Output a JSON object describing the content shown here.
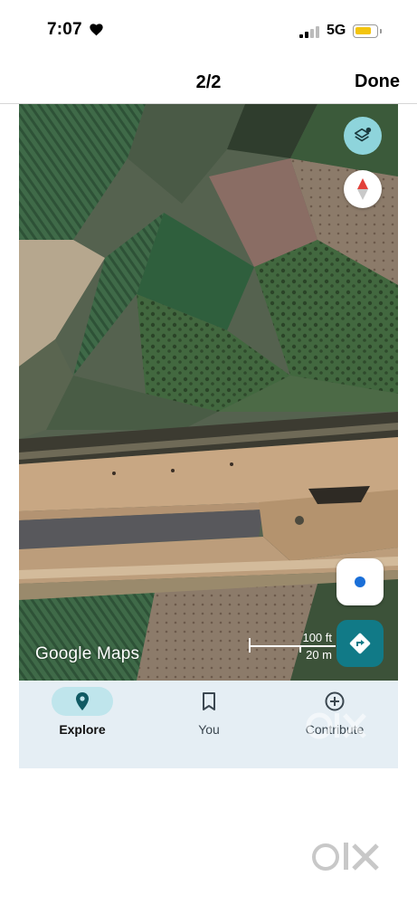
{
  "status_bar": {
    "time": "7:07",
    "network": "5G",
    "battery_color": "#f3c40e"
  },
  "header": {
    "title": "2/2",
    "done_label": "Done"
  },
  "map": {
    "watermark": "Google Maps",
    "scale_imperial": "100 ft",
    "scale_metric": "20 m",
    "accent_color": "#117a87",
    "icons": [
      "layers-icon",
      "compass-icon",
      "my-location-icon",
      "directions-icon"
    ]
  },
  "tabs": [
    {
      "label": "Explore",
      "icon": "explore-pin-icon",
      "selected": true
    },
    {
      "label": "You",
      "icon": "bookmark-icon",
      "selected": false
    },
    {
      "label": "Contribute",
      "icon": "add-circle-icon",
      "selected": false
    }
  ],
  "overlay": {
    "brand": "olx"
  }
}
